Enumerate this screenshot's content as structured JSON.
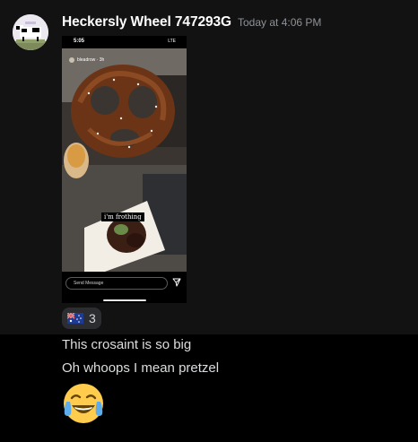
{
  "message": {
    "username": "Heckersly Wheel 747293G",
    "timestamp": "Today at 4:06 PM",
    "avatar_icon": "pixel-cow-avatar",
    "attachment": {
      "status_time": "5:05",
      "status_signal": "LTE",
      "story_user": "bleadrow · 3h",
      "caption": "i'm frothing",
      "send_placeholder": "Send Message",
      "send_icon": "paper-plane-icon"
    },
    "reaction": {
      "emoji": "australia-flag-icon",
      "count": "3"
    },
    "lines": [
      "This crosaint is so big",
      "Oh whoops I mean pretzel"
    ],
    "big_emoji": "face-with-tears-of-joy-icon"
  },
  "colors": {
    "background": "#000000",
    "hover_background": "#121212",
    "username": "#ffffff",
    "timestamp": "#8e9297",
    "text": "#dcddde",
    "reaction_bg": "#2b2d31"
  }
}
